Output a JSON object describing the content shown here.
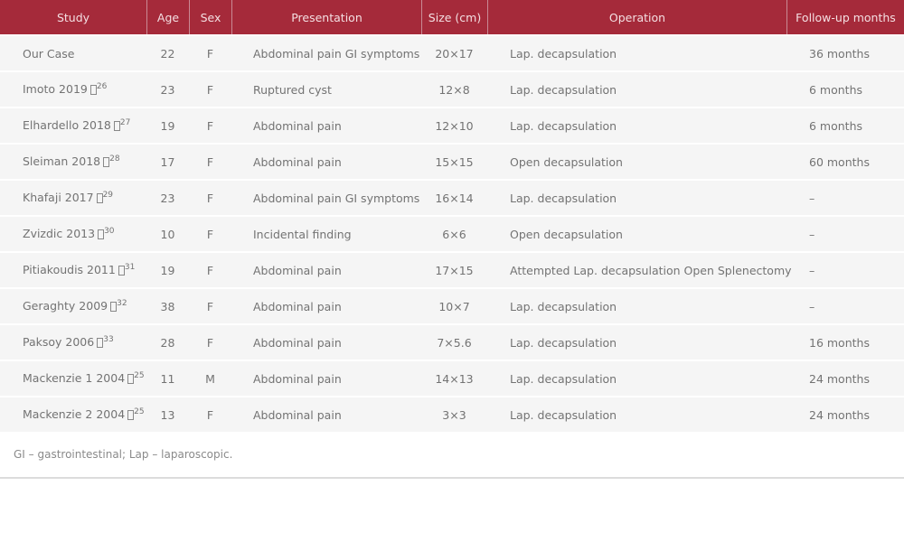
{
  "table": {
    "headers": [
      "Study",
      "Age",
      "Sex",
      "Presentation",
      "Size (cm)",
      "Operation",
      "Follow-up months"
    ],
    "rows": [
      {
        "study": "Our Case",
        "ref": "",
        "age": "22",
        "sex": "F",
        "presentation": "Abdominal pain GI symptoms",
        "size": "20×17",
        "operation": "Lap. decapsulation",
        "followup": "36 months"
      },
      {
        "study": "Imoto 2019",
        "ref": "26",
        "age": "23",
        "sex": "F",
        "presentation": "Ruptured cyst",
        "size": "12×8",
        "operation": "Lap. decapsulation",
        "followup": "6 months"
      },
      {
        "study": "Elhardello 2018",
        "ref": "27",
        "age": "19",
        "sex": "F",
        "presentation": "Abdominal pain",
        "size": "12×10",
        "operation": "Lap. decapsulation",
        "followup": "6 months"
      },
      {
        "study": "Sleiman 2018",
        "ref": "28",
        "age": "17",
        "sex": "F",
        "presentation": "Abdominal pain",
        "size": "15×15",
        "operation": "Open decapsulation",
        "followup": "60 months"
      },
      {
        "study": "Khafaji 2017",
        "ref": "29",
        "age": "23",
        "sex": "F",
        "presentation": "Abdominal pain GI symptoms",
        "size": "16×14",
        "operation": "Lap. decapsulation",
        "followup": "–"
      },
      {
        "study": "Zvizdic 2013",
        "ref": "30",
        "age": "10",
        "sex": "F",
        "presentation": "Incidental finding",
        "size": "6×6",
        "operation": "Open decapsulation",
        "followup": "–"
      },
      {
        "study": "Pitiakoudis 2011",
        "ref": "31",
        "age": "19",
        "sex": "F",
        "presentation": "Abdominal pain",
        "size": "17×15",
        "operation": "Attempted Lap. decapsulation Open Splenectomy",
        "followup": "–"
      },
      {
        "study": "Geraghty 2009",
        "ref": "32",
        "age": "38",
        "sex": "F",
        "presentation": "Abdominal pain",
        "size": "10×7",
        "operation": "Lap. decapsulation",
        "followup": "–"
      },
      {
        "study": "Paksoy 2006",
        "ref": "33",
        "age": "28",
        "sex": "F",
        "presentation": "Abdominal pain",
        "size": "7×5.6",
        "operation": "Lap. decapsulation",
        "followup": "16 months"
      },
      {
        "study": "Mackenzie 1 2004",
        "ref": "25",
        "age": "11",
        "sex": "M",
        "presentation": "Abdominal pain",
        "size": "14×13",
        "operation": "Lap. decapsulation",
        "followup": "24 months"
      },
      {
        "study": "Mackenzie 2 2004",
        "ref": "25",
        "age": "13",
        "sex": "F",
        "presentation": "Abdominal pain",
        "size": "3×3",
        "operation": "Lap. decapsulation",
        "followup": "24 months"
      }
    ]
  },
  "footnote": "GI – gastrointestinal; Lap – laparoscopic.",
  "colors": {
    "header_bg": "#a52a3a",
    "row_bg": "#f5f5f5",
    "text": "#737373"
  }
}
